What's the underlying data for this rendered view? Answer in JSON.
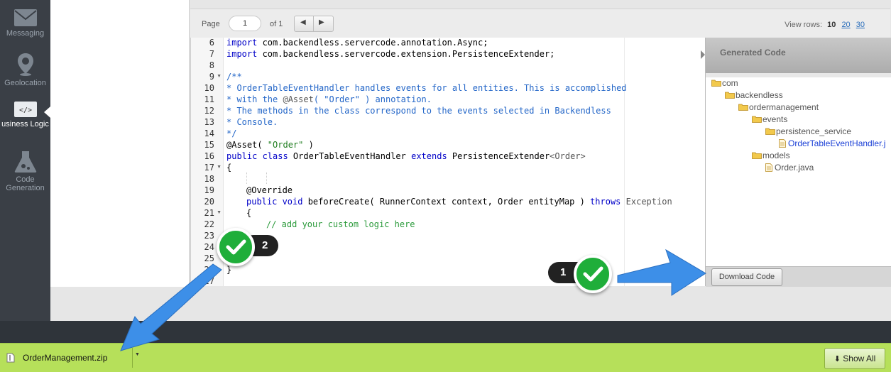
{
  "sidebar": {
    "items": [
      {
        "label": "Messaging",
        "icon": "envelope-icon"
      },
      {
        "label": "Geolocation",
        "icon": "location-pin-icon"
      },
      {
        "label": "usiness Logic",
        "icon": "code-icon",
        "active": true
      },
      {
        "label": "Code Generation",
        "icon": "flask-icon"
      }
    ]
  },
  "pager": {
    "page_label": "Page",
    "page_value": "1",
    "of_label": "of 1",
    "view_rows_label": "View rows:",
    "view_rows_options": [
      "10",
      "20",
      "30"
    ],
    "view_rows_selected": "10"
  },
  "editor": {
    "line_numbers": [
      "6",
      "7",
      "8",
      "9",
      "10",
      "11",
      "12",
      "13",
      "14",
      "15",
      "16",
      "17",
      "18",
      "19",
      "20",
      "21",
      "22",
      "23",
      "24",
      "25",
      "26",
      "27"
    ],
    "lines": {
      "l6": {
        "kw": "import",
        "rest": " com.backendless.servercode.annotation.Async;"
      },
      "l7": {
        "kw": "import",
        "rest": " com.backendless.servercode.extension.PersistenceExtender;"
      },
      "l9": "/**",
      "l10": "* OrderTableEventHandler handles events for all entities. This is accomplished",
      "l11a": "* with the ",
      "l11b": "@Asset",
      "l11c": "( \"Order\" ) annotation.",
      "l12": "* The methods in the class correspond to the events selected in Backendless",
      "l13": "* Console.",
      "l14": "*/",
      "l15a": "@Asset( ",
      "l15b": "\"Order\"",
      "l15c": " )",
      "l16a": "public class",
      "l16b": " OrderTableEventHandler ",
      "l16c": "extends",
      "l16d": " PersistenceExtender",
      "l16e": "<Order>",
      "l17": "{",
      "l19": "@Override",
      "l20a": "public void",
      "l20b": " beforeCreate( RunnerContext context, Order entityMap ) ",
      "l20c": "throws",
      "l20d": " Exception",
      "l21": "{",
      "l22": "// add your custom logic here",
      "l26": "}"
    }
  },
  "generated_code": {
    "title": "Generated Code",
    "tree": [
      {
        "label": "com",
        "type": "folder",
        "depth": 0
      },
      {
        "label": "backendless",
        "type": "folder",
        "depth": 1
      },
      {
        "label": "ordermanagement",
        "type": "folder",
        "depth": 2
      },
      {
        "label": "events",
        "type": "folder",
        "depth": 3
      },
      {
        "label": "persistence_service",
        "type": "folder",
        "depth": 4
      },
      {
        "label": "OrderTableEventHandler.j",
        "type": "file",
        "depth": 5,
        "selected": true
      },
      {
        "label": "models",
        "type": "folder",
        "depth": 3
      },
      {
        "label": "Order.java",
        "type": "file",
        "depth": 4
      }
    ],
    "download_label": "Download Code"
  },
  "annotations": {
    "step1": "1",
    "step2": "2",
    "arrow_color": "#3d8fe8",
    "check_color": "#1fae3a"
  },
  "download_bar": {
    "file_name": "OrderManagement.zip",
    "show_all_label": "Show All"
  },
  "colors": {
    "sidebar": "#3a3f46",
    "download_bar": "#b6e05a",
    "link": "#2a6ebb"
  }
}
